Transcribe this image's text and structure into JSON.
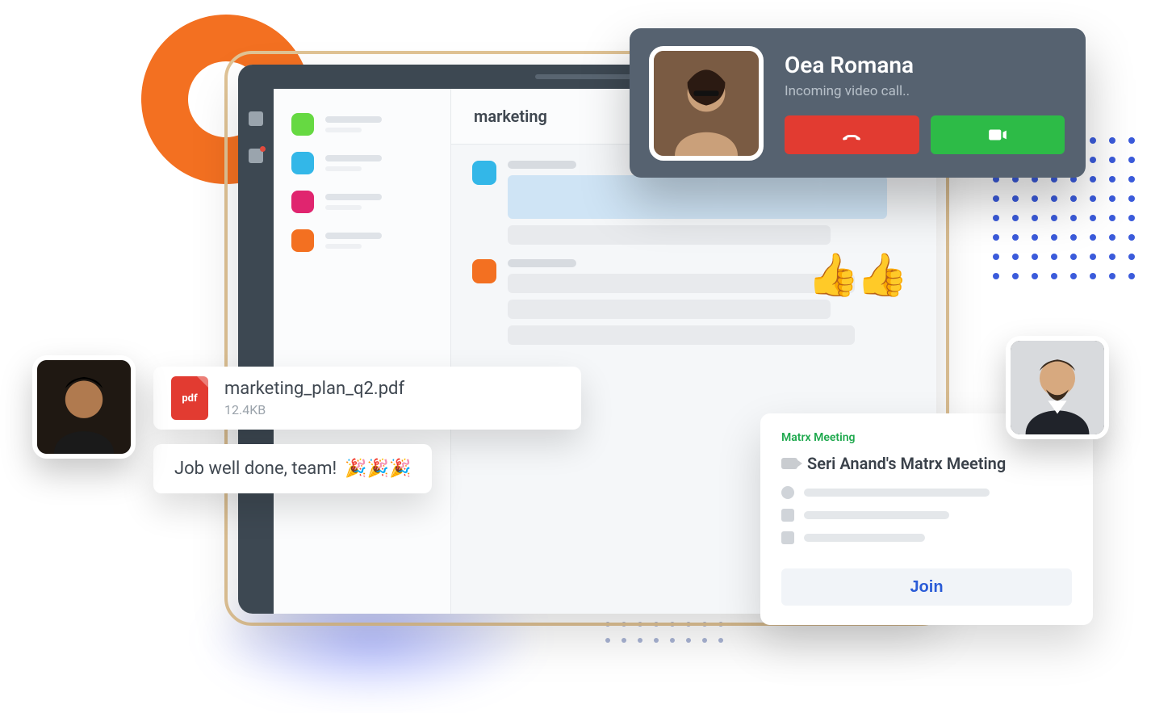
{
  "channel_header": "marketing",
  "sidebar_colors": [
    "#66d942",
    "#33b7e8",
    "#e0256f",
    "#f37021"
  ],
  "thumbs_emoji": "👍👍",
  "call": {
    "name": "Oea Romana",
    "subtitle": "Incoming video call.."
  },
  "attachment": {
    "badge": "pdf",
    "filename": "marketing_plan_q2.pdf",
    "size": "12.4KB"
  },
  "message_card": {
    "text": "Job well done, team!",
    "emoji": "🎉🎉🎉"
  },
  "meeting": {
    "label": "Matrx Meeting",
    "title": "Seri Anand's Matrx Meeting",
    "join_label": "Join"
  }
}
